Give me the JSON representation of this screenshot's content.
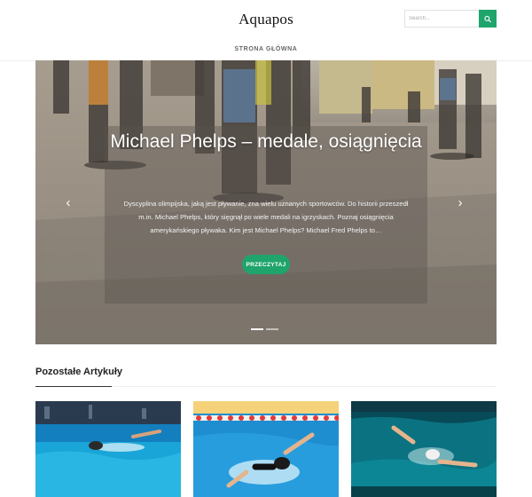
{
  "site": {
    "logo": "Aquapos"
  },
  "search": {
    "placeholder": "Search..."
  },
  "nav": {
    "items": [
      {
        "label": "STRONA GŁÓWNA"
      }
    ]
  },
  "hero": {
    "title": "Michael Phelps – medale, osiągnięcia",
    "excerpt": "Dyscyplina olimpijska, jaką jest pływanie, zna wielu uznanych sportowców. Do historii przeszedł m.in. Michael Phelps, który sięgnął po wiele medali na igrzyskach. Poznaj osiągnięcia amerykańskiego pływaka. Kim jest Michael Phelps? Michael Fred Phelps to…",
    "button_label": "PRZECZYTAJ",
    "slides_total": 2,
    "active_slide": 1
  },
  "section": {
    "title": "Pozostałe Artykuły"
  },
  "icons": {
    "search": "search-icon",
    "prev": "chevron-left-icon",
    "next": "chevron-right-icon"
  },
  "colors": {
    "accent": "#1fa46b"
  }
}
